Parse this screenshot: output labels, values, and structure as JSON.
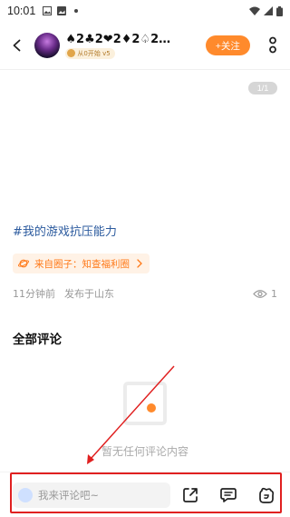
{
  "status_bar": {
    "time": "10:01"
  },
  "header": {
    "username": "♠2♣2❤2♦2♤2…",
    "level": "从0开始 v5",
    "follow_label": "+关注"
  },
  "post": {
    "page_indicator": "1/1",
    "hashtag": "#我的游戏抗压能力",
    "circle_label": "来自圈子：知查福利圈",
    "time_ago": "11分钟前",
    "location": "发布于山东",
    "views": "1"
  },
  "comments": {
    "title": "全部评论",
    "empty_text": "暂无任何评论内容"
  },
  "bottom_bar": {
    "input_placeholder": "我来评论吧~"
  },
  "colors": {
    "accent": "#ff8a2c",
    "hashtag": "#2b5a9e",
    "annotation": "#e02020"
  },
  "icons": [
    "gallery-icon",
    "photo-icon",
    "dot-icon",
    "wifi-icon",
    "signal-icon",
    "battery-icon",
    "back-arrow-icon",
    "more-vertical-icon",
    "planet-icon",
    "chevron-right-icon",
    "eye-icon",
    "empty-box-icon",
    "share-icon",
    "comment-icon",
    "sticker-icon"
  ]
}
